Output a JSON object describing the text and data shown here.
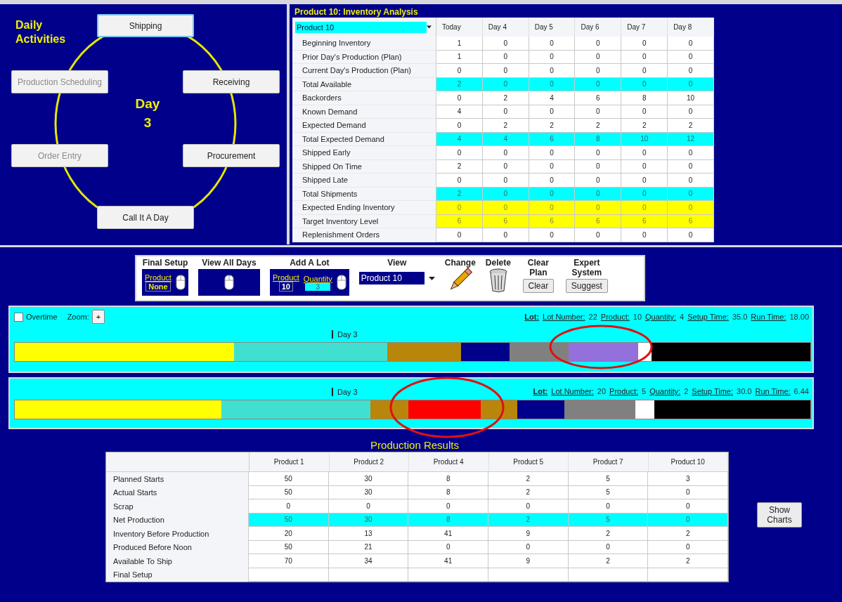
{
  "activities": {
    "title": "Daily Activities",
    "day_label": "Day",
    "day_number": "3",
    "buttons": [
      {
        "label": "Shipping",
        "disabled": false,
        "selected": true
      },
      {
        "label": "Receiving",
        "disabled": false,
        "selected": false
      },
      {
        "label": "Procurement",
        "disabled": false,
        "selected": false
      },
      {
        "label": "Call It A Day",
        "disabled": false,
        "selected": false
      },
      {
        "label": "Order Entry",
        "disabled": true,
        "selected": false
      },
      {
        "label": "Production Scheduling",
        "disabled": true,
        "selected": false
      }
    ]
  },
  "inventory": {
    "title": "Product 10: Inventory Analysis",
    "product_select": "Product 10",
    "columns": [
      "Today",
      "Day 4",
      "Day 5",
      "Day 6",
      "Day 7",
      "Day 8"
    ],
    "rows": [
      {
        "label": "Beginning Inventory",
        "kind": "normal",
        "values": [
          "1",
          "0",
          "0",
          "0",
          "0",
          "0"
        ]
      },
      {
        "label": "Prior Day's Production (Plan)",
        "kind": "normal",
        "values": [
          "1",
          "0",
          "0",
          "0",
          "0",
          "0"
        ]
      },
      {
        "label": "Current Day's Production (Plan)",
        "kind": "normal",
        "values": [
          "0",
          "0",
          "0",
          "0",
          "0",
          "0"
        ]
      },
      {
        "label": "Total Available",
        "kind": "total",
        "values": [
          "2",
          "0",
          "0",
          "0",
          "0",
          "0"
        ]
      },
      {
        "label": "Backorders",
        "kind": "normal",
        "values": [
          "0",
          "2",
          "4",
          "6",
          "8",
          "10"
        ]
      },
      {
        "label": "Known Demand",
        "kind": "normal",
        "values": [
          "4",
          "0",
          "0",
          "0",
          "0",
          "0"
        ]
      },
      {
        "label": "Expected Demand",
        "kind": "normal",
        "values": [
          "0",
          "2",
          "2",
          "2",
          "2",
          "2"
        ]
      },
      {
        "label": "Total Expected Demand",
        "kind": "total",
        "values": [
          "4",
          "4",
          "6",
          "8",
          "10",
          "12"
        ]
      },
      {
        "label": "Shipped Early",
        "kind": "normal",
        "values": [
          "0",
          "0",
          "0",
          "0",
          "0",
          "0"
        ]
      },
      {
        "label": "Shipped On Time",
        "kind": "normal",
        "values": [
          "2",
          "0",
          "0",
          "0",
          "0",
          "0"
        ]
      },
      {
        "label": "Shipped Late",
        "kind": "normal",
        "values": [
          "0",
          "0",
          "0",
          "0",
          "0",
          "0"
        ]
      },
      {
        "label": "Total Shipments",
        "kind": "total",
        "values": [
          "2",
          "0",
          "0",
          "0",
          "0",
          "0"
        ]
      },
      {
        "label": "Expected Ending Inventory",
        "kind": "target",
        "values": [
          "0",
          "0",
          "0",
          "0",
          "0",
          "0"
        ]
      },
      {
        "label": "Target Inventory Level",
        "kind": "target",
        "values": [
          "6",
          "6",
          "6",
          "6",
          "6",
          "6"
        ]
      },
      {
        "label": "Replenishment Orders",
        "kind": "normal",
        "values": [
          "0",
          "0",
          "0",
          "0",
          "0",
          "0"
        ]
      }
    ]
  },
  "toolbar": {
    "final_setup": {
      "title": "Final Setup",
      "product_link": "Product",
      "product_value": "None"
    },
    "view_all_days": {
      "title": "View All Days"
    },
    "add_a_lot": {
      "title": "Add A Lot",
      "product_link": "Product",
      "quantity_link": "Quantity",
      "product_value": "10",
      "quantity_value": "3"
    },
    "view": {
      "title": "View",
      "select": "Product 10"
    },
    "change": {
      "title": "Change"
    },
    "delete": {
      "title": "Delete"
    },
    "clear_plan": {
      "title": "Clear Plan",
      "button": "Clear"
    },
    "expert_system": {
      "title": "Expert System",
      "button": "Suggest"
    }
  },
  "schedules": [
    {
      "overtime_label": "Overtime",
      "overtime_checked": false,
      "zoom_label": "Zoom:",
      "zoom_button": "+",
      "day_marker": "Day 3",
      "lot": {
        "lot_label": "Lot:",
        "lot_number_label": "Lot Number:",
        "lot_number": "22",
        "product_label": "Product:",
        "product": "10",
        "quantity_label": "Quantity:",
        "quantity": "4",
        "setup_label": "Setup Time:",
        "setup": "35.0",
        "run_label": "Run Time:",
        "run": "18.00"
      },
      "segments": [
        {
          "color": "#ffff00"
        },
        {
          "color": "#40e0d0"
        },
        {
          "color": "#b8860b"
        },
        {
          "color": "#00008b"
        },
        {
          "color": "#808080"
        },
        {
          "color": "#9370db"
        },
        {
          "color": "#ffffff"
        },
        {
          "color": "#000000"
        }
      ]
    },
    {
      "day_marker": "Day 3",
      "lot": {
        "lot_label": "Lot:",
        "lot_number_label": "Lot Number:",
        "lot_number": "20",
        "product_label": "Product:",
        "product": "5",
        "quantity_label": "Quantity:",
        "quantity": "2",
        "setup_label": "Setup Time:",
        "setup": "30.0",
        "run_label": "Run Time:",
        "run": "6.44"
      },
      "segments": [
        {
          "color": "#ffff00"
        },
        {
          "color": "#40e0d0"
        },
        {
          "color": "#b8860b"
        },
        {
          "color": "#ff0000"
        },
        {
          "color": "#b8860b"
        },
        {
          "color": "#00008b"
        },
        {
          "color": "#808080"
        },
        {
          "color": "#ffffff"
        },
        {
          "color": "#000000"
        }
      ]
    }
  ],
  "production_results": {
    "title": "Production Results",
    "columns": [
      "Product 1",
      "Product 2",
      "Product 4",
      "Product 5",
      "Product 7",
      "Product 10"
    ],
    "rows": [
      {
        "label": "Planned Starts",
        "kind": "normal",
        "values": [
          "50",
          "30",
          "8",
          "2",
          "5",
          "3"
        ]
      },
      {
        "label": "Actual Starts",
        "kind": "normal",
        "values": [
          "50",
          "30",
          "8",
          "2",
          "5",
          "0"
        ]
      },
      {
        "label": "Scrap",
        "kind": "normal",
        "values": [
          "0",
          "0",
          "0",
          "0",
          "0",
          "0"
        ]
      },
      {
        "label": "Net Production",
        "kind": "total",
        "values": [
          "50",
          "30",
          "8",
          "2",
          "5",
          "0"
        ]
      },
      {
        "label": "Inventory Before Production",
        "kind": "normal",
        "values": [
          "20",
          "13",
          "41",
          "9",
          "2",
          "2"
        ]
      },
      {
        "label": "Produced Before Noon",
        "kind": "normal",
        "values": [
          "50",
          "21",
          "0",
          "0",
          "0",
          "0"
        ]
      },
      {
        "label": "Available To Ship",
        "kind": "normal",
        "values": [
          "70",
          "34",
          "41",
          "9",
          "2",
          "2"
        ]
      },
      {
        "label": "Final Setup",
        "kind": "normal"
      }
    ]
  },
  "show_charts_button": "Show Charts"
}
